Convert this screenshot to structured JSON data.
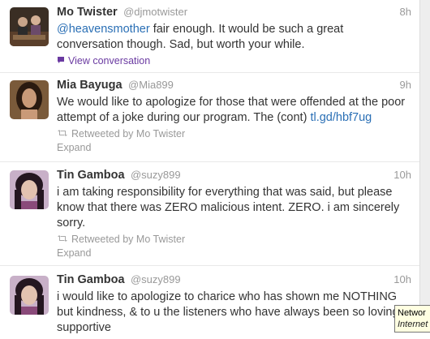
{
  "tweets": [
    {
      "name": "Mo Twister",
      "handle": "@djmotwister",
      "time": "8h",
      "mention": "@heavensmother",
      "text": " fair enough. It would be such a great conversation though. Sad, but worth your while.",
      "action": "View conversation"
    },
    {
      "name": "Mia Bayuga",
      "handle": "@Mia899",
      "time": "9h",
      "text": "We would like to apologize for those that were offended at the poor attempt of a joke during our program. The (cont) ",
      "link": "tl.gd/hbf7ug",
      "retweet": "Retweeted by Mo Twister",
      "expand": "Expand"
    },
    {
      "name": "Tin Gamboa",
      "handle": "@suzy899",
      "time": "10h",
      "text": "i am taking responsibility for everything that was said, but please know that there was ZERO malicious intent. ZERO. i am sincerely sorry.",
      "retweet": "Retweeted by Mo Twister",
      "expand": "Expand"
    },
    {
      "name": "Tin Gamboa",
      "handle": "@suzy899",
      "time": "10h",
      "text": "i would like to apologize to charice who has shown me NOTHING but kindness, & to u the listeners who have always been so loving & supportive"
    }
  ],
  "tooltip": {
    "line1": "Networ",
    "line2": "Internet"
  },
  "colors": {
    "link": "#2a6fb5",
    "conversation": "#6a3aa1",
    "muted": "#999999"
  }
}
